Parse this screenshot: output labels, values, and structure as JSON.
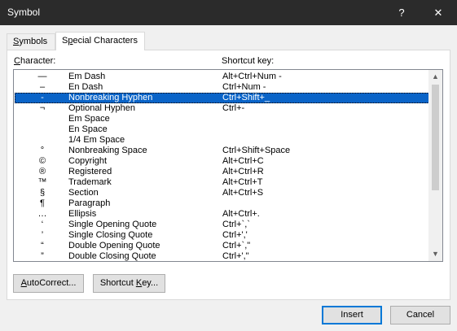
{
  "window": {
    "title": "Symbol",
    "help_glyph": "?",
    "close_glyph": "✕"
  },
  "tabs": [
    {
      "label_prefix": "",
      "mnemonic": "S",
      "label_rest": "ymbols",
      "active": false
    },
    {
      "label_prefix": "S",
      "mnemonic": "p",
      "label_rest": "ecial Characters",
      "active": true
    }
  ],
  "columns": {
    "character": {
      "mnemonic": "C",
      "rest": "haracter:"
    },
    "shortcut": {
      "label": "Shortcut key:"
    }
  },
  "characters": [
    {
      "glyph": "—",
      "name": "Em Dash",
      "key": "Alt+Ctrl+Num -"
    },
    {
      "glyph": "–",
      "name": "En Dash",
      "key": "Ctrl+Num -"
    },
    {
      "glyph": "-",
      "name": "Nonbreaking Hyphen",
      "key": "Ctrl+Shift+_",
      "selected": true
    },
    {
      "glyph": "¬",
      "name": "Optional Hyphen",
      "key": "Ctrl+-"
    },
    {
      "glyph": "",
      "name": "Em Space",
      "key": ""
    },
    {
      "glyph": "",
      "name": "En Space",
      "key": ""
    },
    {
      "glyph": "",
      "name": "1/4 Em Space",
      "key": ""
    },
    {
      "glyph": "°",
      "name": "Nonbreaking Space",
      "key": "Ctrl+Shift+Space"
    },
    {
      "glyph": "©",
      "name": "Copyright",
      "key": "Alt+Ctrl+C"
    },
    {
      "glyph": "®",
      "name": "Registered",
      "key": "Alt+Ctrl+R"
    },
    {
      "glyph": "™",
      "name": "Trademark",
      "key": "Alt+Ctrl+T"
    },
    {
      "glyph": "§",
      "name": "Section",
      "key": "Alt+Ctrl+S"
    },
    {
      "glyph": "¶",
      "name": "Paragraph",
      "key": ""
    },
    {
      "glyph": "…",
      "name": "Ellipsis",
      "key": "Alt+Ctrl+."
    },
    {
      "glyph": "‘",
      "name": "Single Opening Quote",
      "key": "Ctrl+`,`"
    },
    {
      "glyph": "’",
      "name": "Single Closing Quote",
      "key": "Ctrl+','"
    },
    {
      "glyph": "“",
      "name": "Double Opening Quote",
      "key": "Ctrl+`,\""
    },
    {
      "glyph": "”",
      "name": "Double Closing Quote",
      "key": "Ctrl+',\""
    }
  ],
  "buttons": {
    "autocorrect": {
      "mnemonic": "A",
      "rest": "utoCorrect..."
    },
    "shortcut": {
      "prefix": "Shortcut ",
      "mnemonic": "K",
      "rest": "ey..."
    },
    "insert": {
      "label": "Insert"
    },
    "cancel": {
      "label": "Cancel"
    }
  },
  "scrollbar": {
    "up_glyph": "▲",
    "down_glyph": "▼"
  }
}
